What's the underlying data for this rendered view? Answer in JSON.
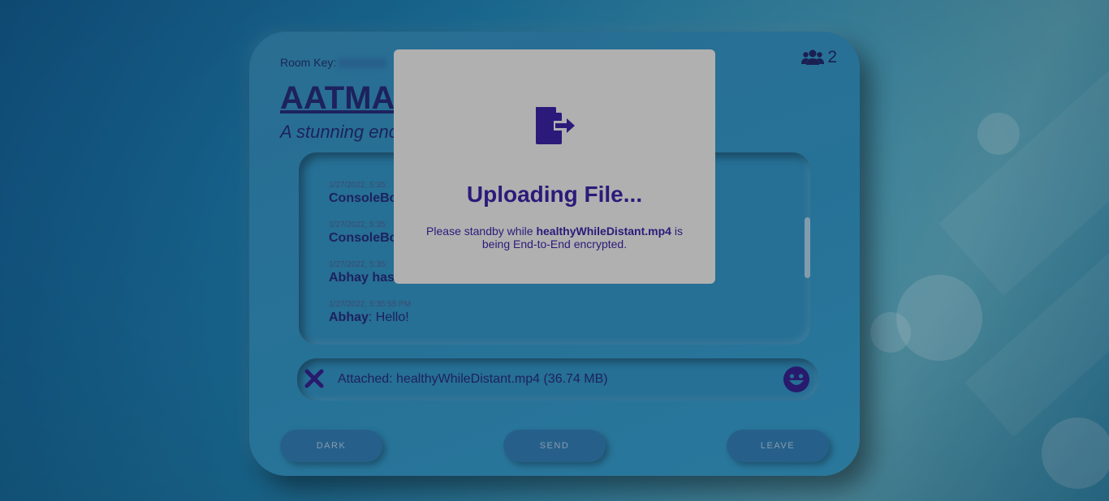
{
  "room": {
    "key_label": "Room Key:",
    "user_count": "2",
    "title": "AATMA",
    "subtitle": "A stunning enc"
  },
  "messages": [
    {
      "time": "1/27/2022, 5:35:",
      "sender": "ConsoleBo",
      "text": ""
    },
    {
      "time": "1/27/2022, 5:35:",
      "sender": "ConsoleBo",
      "text": ""
    },
    {
      "time": "1/27/2022, 5:35:",
      "sender": "Abhay has",
      "text": ""
    },
    {
      "time": "1/27/2022, 5:35:55 PM",
      "sender": "Abhay",
      "text": ": Hello!"
    }
  ],
  "attachment": {
    "text": "Attached: healthyWhileDistant.mp4 (36.74 MB)"
  },
  "buttons": {
    "dark": "DARK",
    "send": "SEND",
    "leave": "LEAVE"
  },
  "modal": {
    "title": "Uploading File...",
    "body_prefix": "Please standby while ",
    "filename": "healthyWhileDistant.mp4",
    "body_suffix": " is being End-to-End encrypted."
  },
  "icons": {
    "users": "users-icon",
    "close": "close-icon",
    "emoji": "smiley-icon",
    "file_export": "file-export-icon"
  },
  "colors": {
    "accent": "#2c1a7a",
    "card": "#2a86ae",
    "modal_bg": "#b0b0b0"
  }
}
